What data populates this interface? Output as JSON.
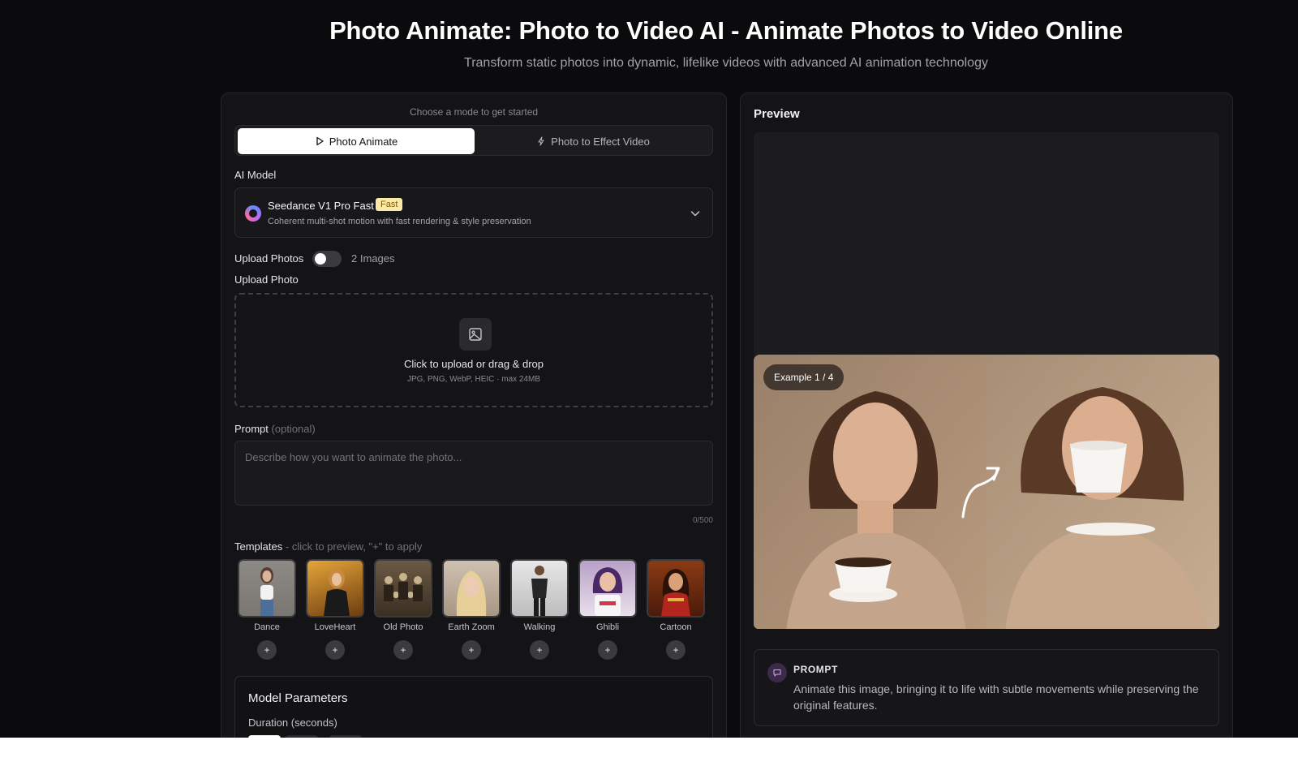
{
  "hero": {
    "title": "Photo Animate: Photo to Video AI - Animate Photos to Video Online",
    "subtitle": "Transform static photos into dynamic, lifelike videos with advanced AI animation technology"
  },
  "modes": {
    "hint": "Choose a mode to get started",
    "items": [
      {
        "label": "Photo Animate",
        "icon": "play-icon",
        "active": true
      },
      {
        "label": "Photo to Effect Video",
        "icon": "sparkle-icon",
        "active": false
      }
    ]
  },
  "model": {
    "label": "AI Model",
    "name": "Seedance V1 Pro Fast",
    "badge": "Fast",
    "description": "Coherent multi-shot motion with fast rendering & style preservation"
  },
  "upload": {
    "toggle_label": "Upload Photos",
    "toggle_after": "2 Images",
    "toggle_on": false,
    "label": "Upload Photo",
    "main_text": "Click to upload or drag & drop",
    "sub_text": "JPG, PNG, WebP, HEIC · max 24MB"
  },
  "prompt": {
    "label": "Prompt",
    "optional": "(optional)",
    "placeholder": "Describe how you want to animate the photo...",
    "value": "",
    "counter": "0/500"
  },
  "templates": {
    "label": "Templates",
    "hint": "- click to preview, \"+\" to apply",
    "items": [
      {
        "name": "Dance",
        "add": "+"
      },
      {
        "name": "LoveHeart",
        "add": "+"
      },
      {
        "name": "Old Photo",
        "add": "+"
      },
      {
        "name": "Earth Zoom",
        "add": "+"
      },
      {
        "name": "Walking",
        "add": "+"
      },
      {
        "name": "Ghibli",
        "add": "+"
      },
      {
        "name": "Cartoon",
        "add": "+"
      }
    ]
  },
  "params": {
    "title": "Model Parameters",
    "duration_label": "Duration (seconds)"
  },
  "preview": {
    "title": "Preview",
    "example_badge": "Example 1 / 4",
    "prompt_label": "PROMPT",
    "prompt_text": "Animate this image, bringing it to life with subtle movements while preserving the original features."
  },
  "colors": {
    "background": "#0b0b0d",
    "card": "#141416",
    "badge_fast": "#fbe9a8",
    "accent_white": "#ffffff"
  }
}
